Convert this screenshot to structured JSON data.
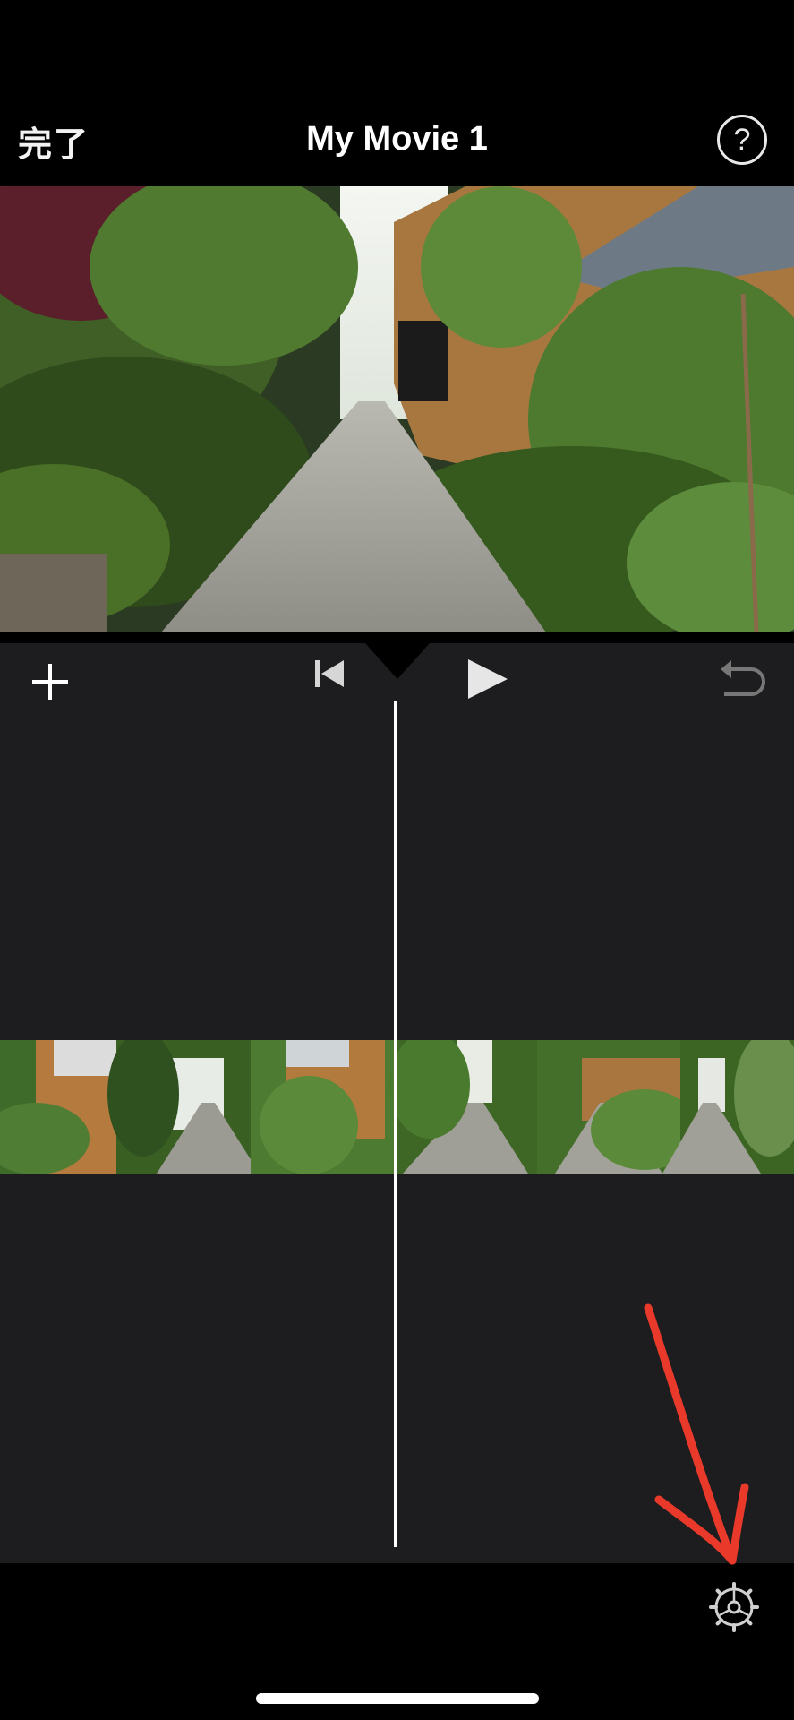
{
  "nav": {
    "done_label": "完了",
    "title": "My Movie 1",
    "help_label": "?"
  },
  "icons": {
    "help": "question-mark-circle-icon",
    "add": "plus-icon",
    "skip_to_start": "skip-to-start-icon",
    "play": "play-icon",
    "undo": "undo-icon",
    "settings": "gear-icon"
  },
  "colors": {
    "background": "#000000",
    "timeline_background": "#1d1d1f",
    "playhead": "#ffffff",
    "annotation": "#e8392b"
  }
}
